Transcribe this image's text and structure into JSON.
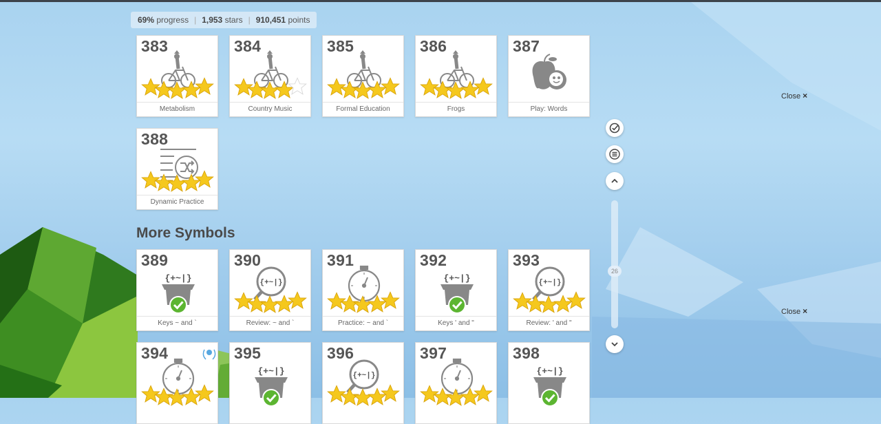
{
  "stats": {
    "progress_value": "69%",
    "progress_label": "progress",
    "stars_value": "1,953",
    "stars_label": "stars",
    "points_value": "910,451",
    "points_label": "points"
  },
  "lessons_top": [
    {
      "number": "383",
      "label": "Metabolism",
      "icon": "bicycle-icon",
      "stars": 5
    },
    {
      "number": "384",
      "label": "Country Music",
      "icon": "bicycle-icon",
      "stars": 4
    },
    {
      "number": "385",
      "label": "Formal Education",
      "icon": "bicycle-icon",
      "stars": 5
    },
    {
      "number": "386",
      "label": "Frogs",
      "icon": "bicycle-icon",
      "stars": 5
    },
    {
      "number": "387",
      "label": "Play: Words",
      "icon": "apple-game-icon",
      "stars": 0
    },
    {
      "number": "388",
      "label": "Dynamic Practice",
      "icon": "shuffle-list-icon",
      "stars": 5
    }
  ],
  "section": {
    "title": "More Symbols"
  },
  "lessons_symbols": [
    {
      "number": "389",
      "label": "Keys ~ and `",
      "icon": "symbols-box-icon",
      "stars": 0,
      "completed": true
    },
    {
      "number": "390",
      "label": "Review: ~ and `",
      "icon": "magnifier-symbols-icon",
      "stars": 5
    },
    {
      "number": "391",
      "label": "Practice: ~ and `",
      "icon": "stopwatch-icon",
      "stars": 5
    },
    {
      "number": "392",
      "label": "Keys ' and \"",
      "icon": "symbols-box-icon",
      "stars": 0,
      "completed": true
    },
    {
      "number": "393",
      "label": "Review: ' and \"",
      "icon": "magnifier-symbols-icon",
      "stars": 5
    },
    {
      "number": "394",
      "label": "",
      "icon": "stopwatch-icon",
      "stars": 5,
      "badge": "laurel-badge-icon"
    },
    {
      "number": "395",
      "label": "",
      "icon": "symbols-box-icon",
      "stars": 0,
      "completed": true
    },
    {
      "number": "396",
      "label": "",
      "icon": "magnifier-symbols-icon",
      "stars": 5
    },
    {
      "number": "397",
      "label": "",
      "icon": "stopwatch-icon",
      "stars": 5
    },
    {
      "number": "398",
      "label": "",
      "icon": "symbols-box-icon",
      "stars": 0,
      "completed": true
    }
  ],
  "symbols_glyph": "{+~|}",
  "close_buttons": [
    {
      "label": "Close",
      "glyph": "×"
    },
    {
      "label": "Close",
      "glyph": "×"
    }
  ],
  "scroll": {
    "position_label": "26"
  },
  "colors": {
    "star": "#f5c81d",
    "check": "#5cb531",
    "accent": "#3a80c4"
  }
}
